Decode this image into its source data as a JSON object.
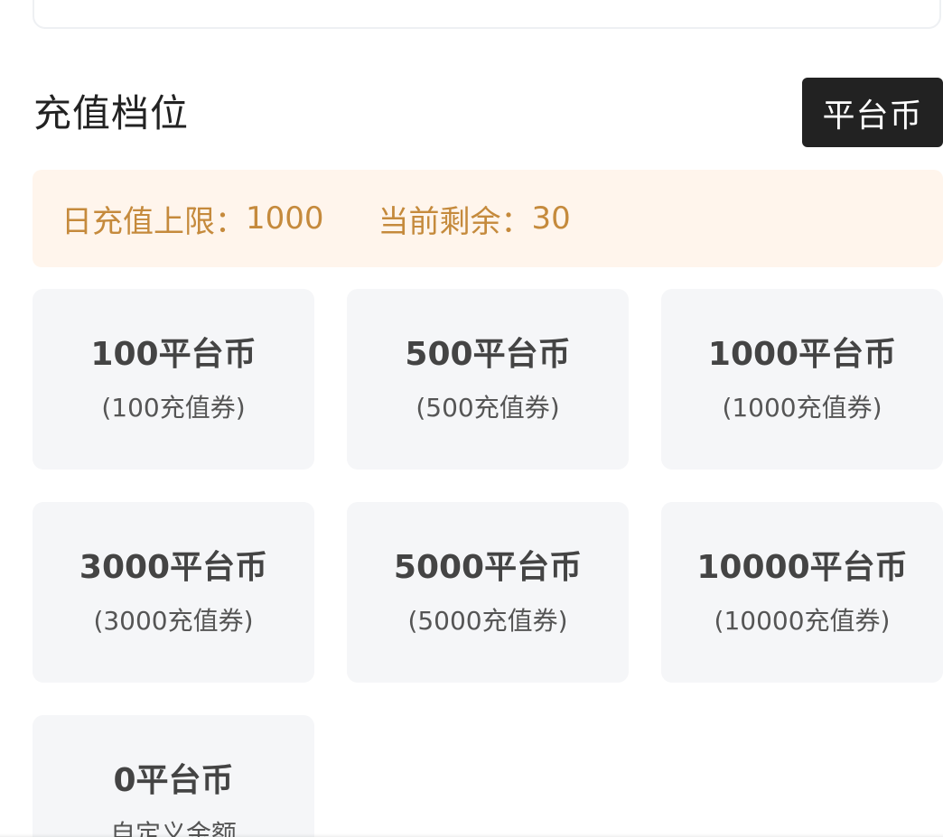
{
  "section": {
    "title": "充值档位"
  },
  "currency_button": {
    "label": "平台币"
  },
  "limit": {
    "daily_label": "日充值上限：",
    "daily_value": "1000",
    "remaining_label": "当前剩余：",
    "remaining_value": "30"
  },
  "tiers": [
    {
      "amount": "100平台币",
      "sub": "(100充值券)"
    },
    {
      "amount": "500平台币",
      "sub": "(500充值券)"
    },
    {
      "amount": "1000平台币",
      "sub": "(1000充值券)"
    },
    {
      "amount": "3000平台币",
      "sub": "(3000充值券)"
    },
    {
      "amount": "5000平台币",
      "sub": "(5000充值券)"
    },
    {
      "amount": "10000平台币",
      "sub": "(10000充值券)"
    },
    {
      "amount": "0平台币",
      "sub": "自定义金额"
    }
  ],
  "colors": {
    "banner_text": "#c58a3c",
    "banner_bg": "#fff5ec",
    "button_bg": "#222222",
    "card_bg": "#f5f6f8"
  }
}
